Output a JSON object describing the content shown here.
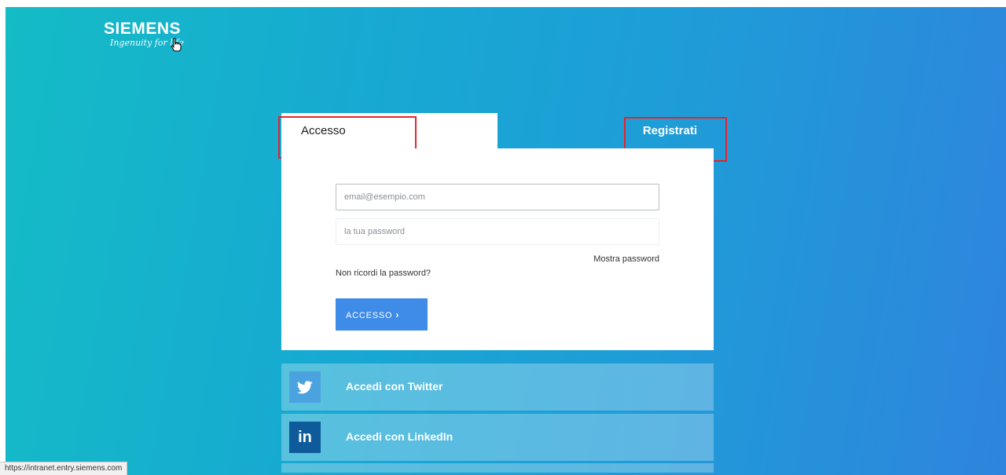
{
  "brand": {
    "name": "SIEMENS",
    "tagline": "Ingenuity for life"
  },
  "tabs": {
    "login_label": "Accesso",
    "register_label": "Registrati"
  },
  "login_form": {
    "email_placeholder": "email@esempio.com",
    "password_placeholder": "la tua password",
    "show_password_label": "Mostra password",
    "forgot_password_label": "Non ricordi la password?",
    "submit_label": "ACCESSO",
    "submit_icon": "chevron-right-icon"
  },
  "social_logins": [
    {
      "label": "Accedi con Twitter",
      "icon": "twitter-icon"
    },
    {
      "label": "Accedi con LinkedIn",
      "icon": "linkedin-icon"
    }
  ],
  "status_bar": {
    "url": "https://intranet.entry.siemens.com"
  },
  "colors": {
    "background_gradient_start": "#14bcc6",
    "background_gradient_end": "#2f84dd",
    "primary_button": "#3f8ce8",
    "highlight_box": "#e0262d"
  }
}
